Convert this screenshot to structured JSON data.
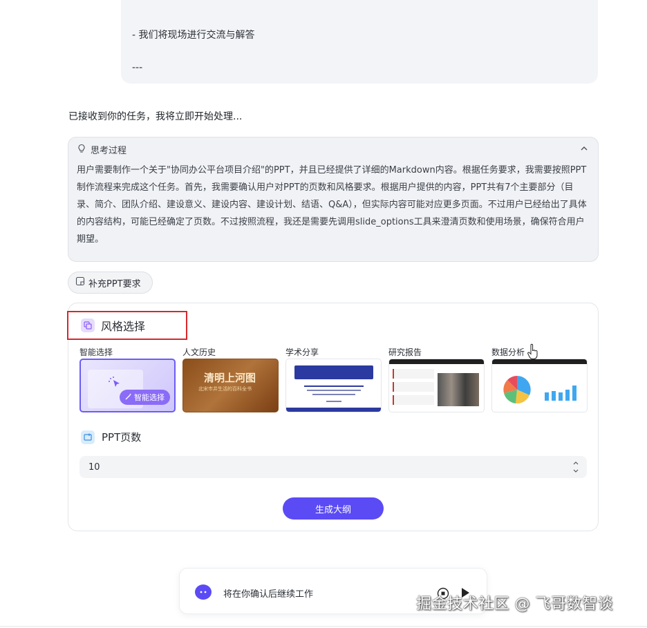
{
  "user_message": {
    "line1": "- 我们将现场进行交流与解答",
    "line2": "---"
  },
  "assistant_ack": "已接收到你的任务，我将立即开始处理...",
  "thinking": {
    "title": "思考过程",
    "icon": "lightbulb-icon",
    "body": "用户需要制作一个关于\"协同办公平台项目介绍\"的PPT，并且已经提供了详细的Markdown内容。根据任务要求，我需要按照PPT制作流程来完成这个任务。首先，我需要确认用户对PPT的页数和风格要求。根据用户提供的内容，PPT共有7个主要部分（目录、简介、团队介绍、建设意义、建设内容、建设计划、结语、Q&A），但实际内容可能对应更多页面。不过用户已经给出了具体的内容结构，可能已经确定了页数。不过按照流程，我还是需要先调用slide_options工具来澄清页数和使用场景，确保符合用户期望。"
  },
  "supplement_button": "补充PPT要求",
  "style_section": {
    "title": "风格选择",
    "options": [
      {
        "name": "智能选择",
        "selected": true,
        "badge": "智能选择"
      },
      {
        "name": "人文历史",
        "selected": false,
        "thumb_title": "清明上河图",
        "thumb_sub": "北宋市井生活的百科全书"
      },
      {
        "name": "学术分享",
        "selected": false
      },
      {
        "name": "研究报告",
        "selected": false
      },
      {
        "name": "数据分析",
        "selected": false
      }
    ]
  },
  "pages_section": {
    "title": "PPT页数",
    "value": "10"
  },
  "generate_button": "生成大纲",
  "bottom_bar": {
    "message": "将在你确认后继续工作"
  },
  "watermark": "掘金技术社区 @ 飞哥数智谈",
  "colors": {
    "accent": "#5b4bf5",
    "highlight_border": "#d9262c"
  }
}
